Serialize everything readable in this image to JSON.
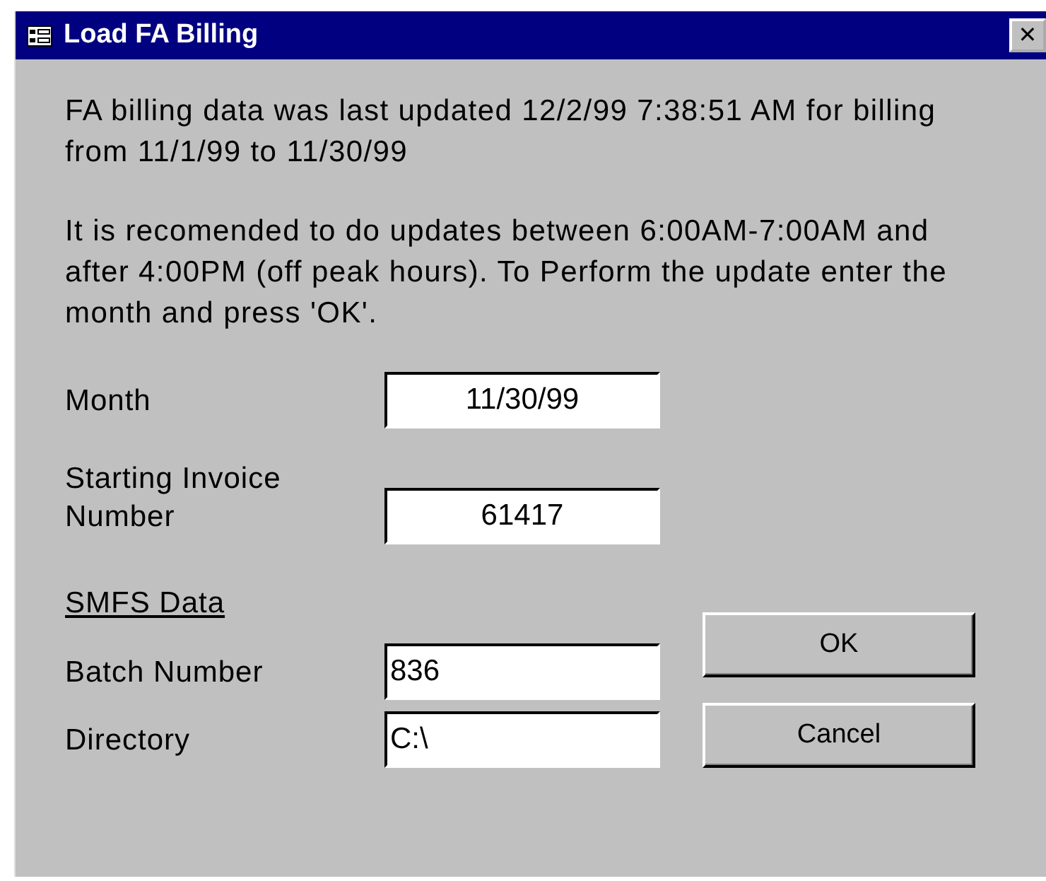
{
  "window": {
    "title": "Load FA Billing",
    "close": "✕"
  },
  "message": [
    "FA billing data was last updated 12/2/99 7:38:51 AM for billing from 11/1/99 to 11/30/99",
    "It is recomended to do updates between 6:00AM-7:00AM and after 4:00PM (off peak hours).  To Perform the update enter the month and press 'OK'."
  ],
  "fields": [
    {
      "label": "Month",
      "value": "11/30/99",
      "kind": "centered"
    },
    {
      "label": "Starting Invoice Number",
      "value": "61417",
      "kind": "centered"
    }
  ],
  "section": {
    "heading": "SMFS Data",
    "fields": [
      {
        "label": "Batch Number",
        "value": "836",
        "kind": "plain"
      },
      {
        "label": "Directory",
        "value": "C:\\",
        "kind": "plain"
      }
    ]
  },
  "buttons": [
    "OK",
    "Cancel"
  ]
}
